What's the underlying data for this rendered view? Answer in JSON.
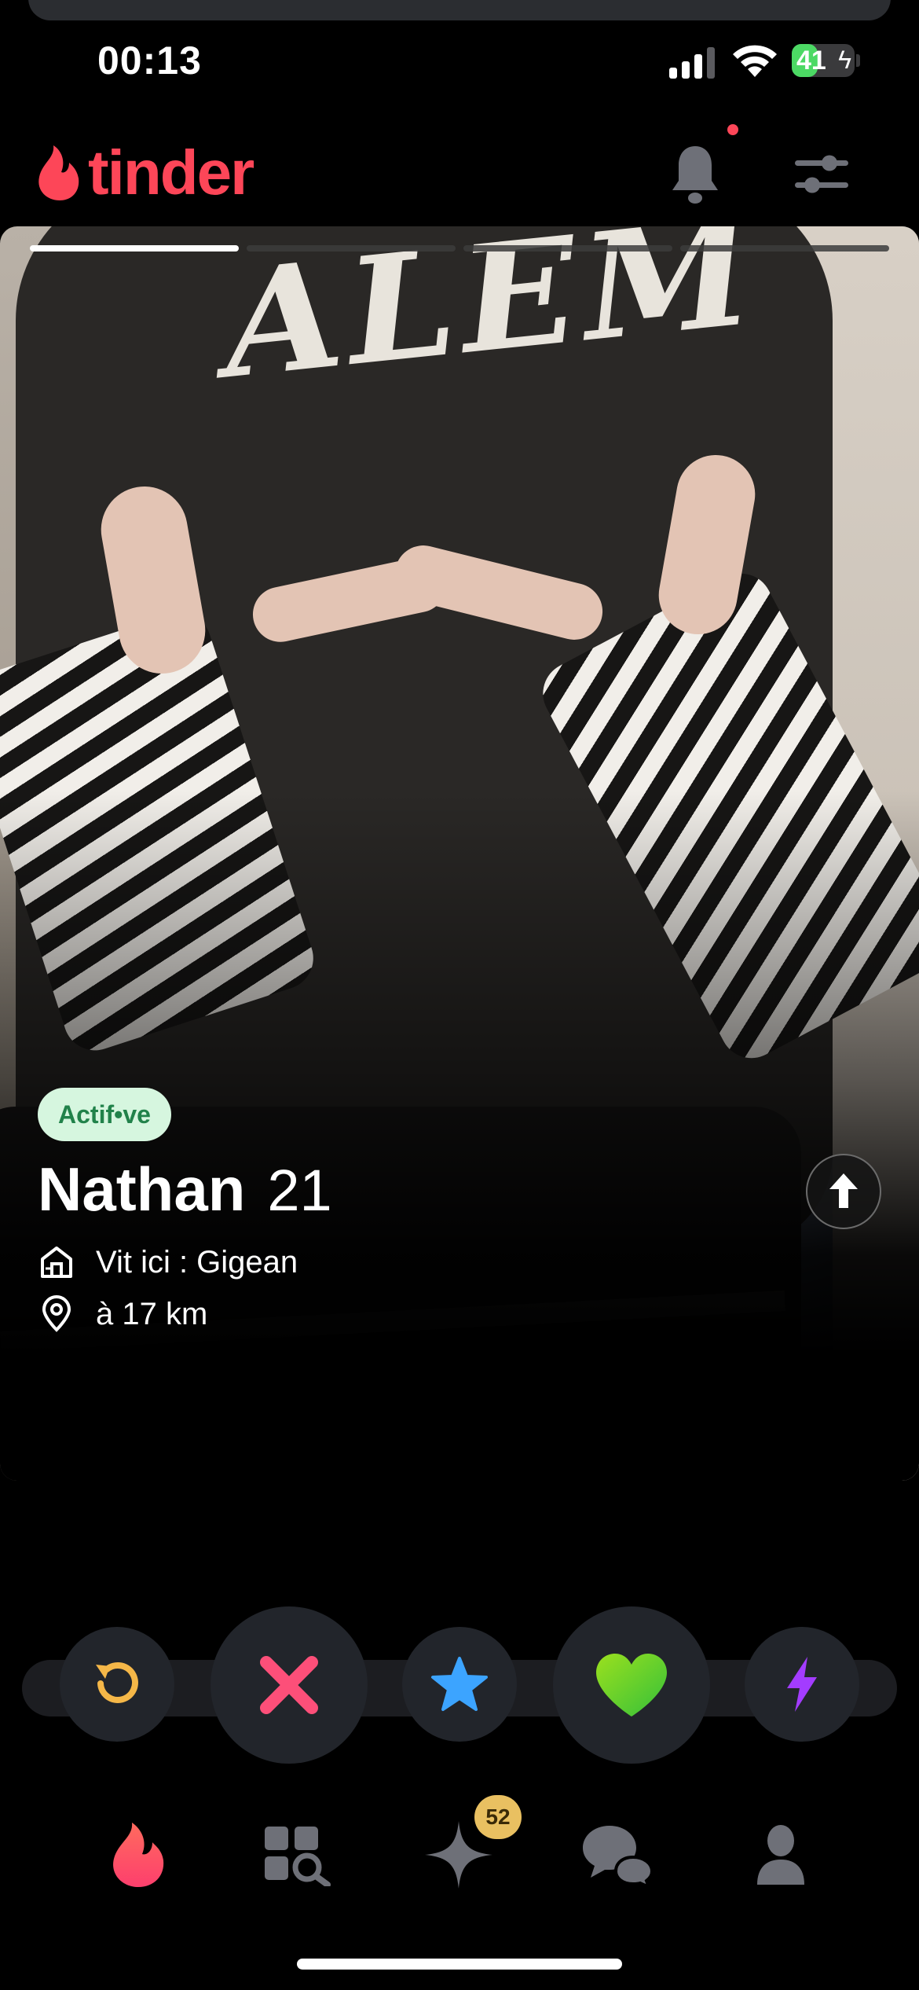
{
  "status_bar": {
    "time": "00:13",
    "battery_level": "41",
    "battery_charging": true,
    "signal_bars_active": 3,
    "signal_bars_total": 4,
    "battery_fill_fraction": 0.41
  },
  "header": {
    "logo_text": "tinder",
    "notifications_unread": true,
    "brand_color": "#fd4658"
  },
  "profile": {
    "photo_count": 4,
    "current_photo_index": 1,
    "status_badge": "Actif•ve",
    "name": "Nathan",
    "age": "21",
    "lives_in": "Vit ici : Gigean",
    "distance": "à 17 km"
  },
  "actions": [
    {
      "name": "rewind",
      "icon": "rewind-icon",
      "color": "#f5b748"
    },
    {
      "name": "nope",
      "icon": "close-icon",
      "color": "#fd4f79"
    },
    {
      "name": "super-like",
      "icon": "star-icon",
      "color": "#3ca4ff"
    },
    {
      "name": "like",
      "icon": "heart-icon",
      "color": "#6dd42a"
    },
    {
      "name": "boost",
      "icon": "lightning-icon",
      "color": "#a33cff"
    }
  ],
  "tab_bar": {
    "tabs": [
      {
        "name": "home",
        "icon": "flame-icon",
        "active": true
      },
      {
        "name": "explore",
        "icon": "explore-icon",
        "active": false
      },
      {
        "name": "gold",
        "icon": "sparkle-icon",
        "active": false
      },
      {
        "name": "messages",
        "icon": "chat-icon",
        "active": false
      },
      {
        "name": "profile",
        "icon": "person-icon",
        "active": false
      }
    ],
    "gold_badge_count": "52"
  }
}
